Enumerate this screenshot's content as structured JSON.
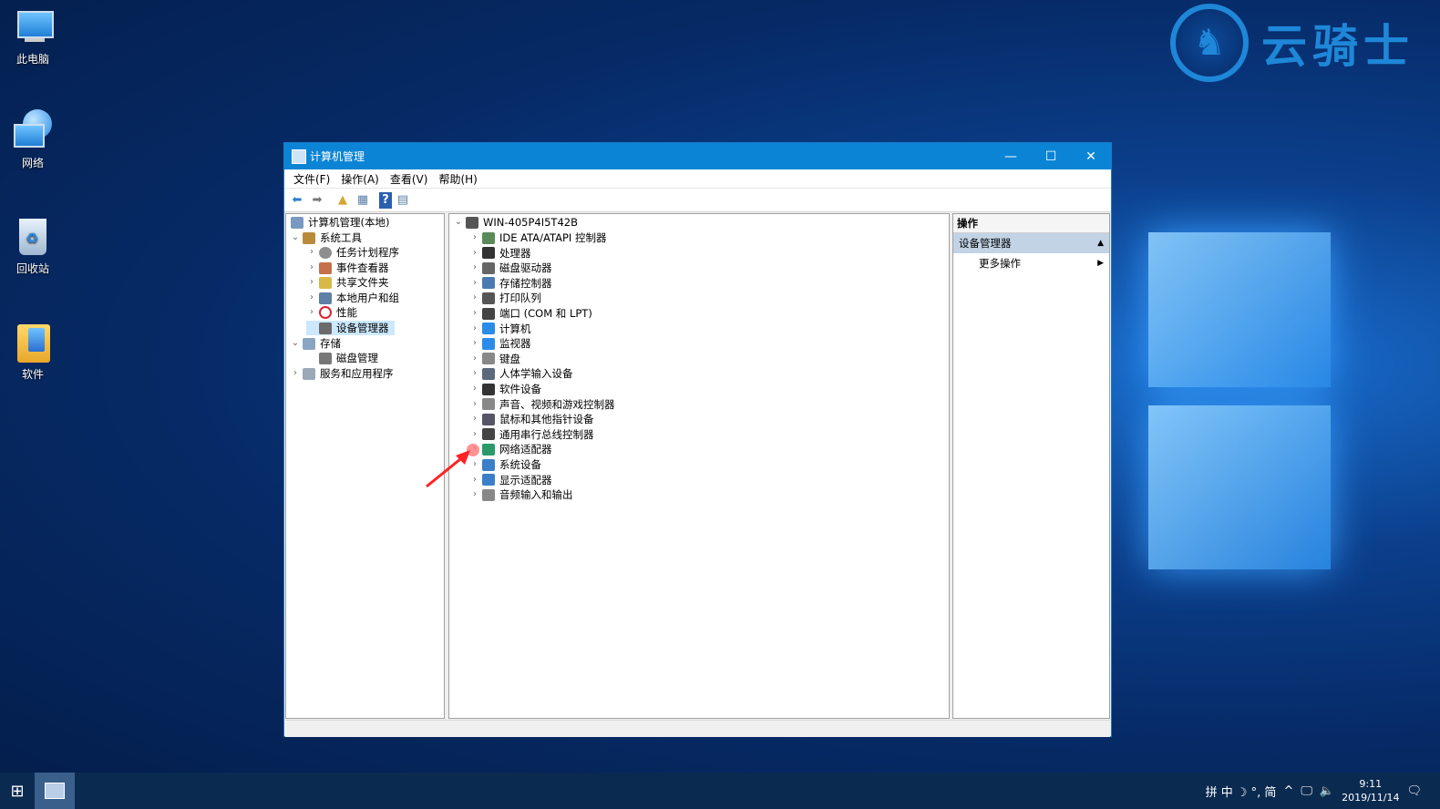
{
  "desktop": {
    "icons": [
      {
        "label": "此电脑"
      },
      {
        "label": "网络"
      },
      {
        "label": "回收站"
      },
      {
        "label": "软件"
      }
    ],
    "brand": "云骑士"
  },
  "window": {
    "title": "计算机管理",
    "controls": {
      "minimize": "—",
      "maximize": "☐",
      "close": "✕"
    },
    "menu": [
      "文件(F)",
      "操作(A)",
      "查看(V)",
      "帮助(H)"
    ]
  },
  "left_tree": [
    {
      "label": "计算机管理(本地)",
      "level": 0,
      "chevron": ""
    },
    {
      "label": "系统工具",
      "level": 1,
      "chevron": "⌄"
    },
    {
      "label": "任务计划程序",
      "level": 2,
      "chevron": "›"
    },
    {
      "label": "事件查看器",
      "level": 2,
      "chevron": "›"
    },
    {
      "label": "共享文件夹",
      "level": 2,
      "chevron": "›"
    },
    {
      "label": "本地用户和组",
      "level": 2,
      "chevron": "›"
    },
    {
      "label": "性能",
      "level": 2,
      "chevron": "›"
    },
    {
      "label": "设备管理器",
      "level": 2,
      "chevron": "",
      "selected": true
    },
    {
      "label": "存储",
      "level": 1,
      "chevron": "⌄"
    },
    {
      "label": "磁盘管理",
      "level": 2,
      "chevron": ""
    },
    {
      "label": "服务和应用程序",
      "level": 1,
      "chevron": "›"
    }
  ],
  "device_tree": {
    "root": "WIN-405P4I5T42B",
    "items": [
      "IDE ATA/ATAPI 控制器",
      "处理器",
      "磁盘驱动器",
      "存储控制器",
      "打印队列",
      "端口 (COM 和 LPT)",
      "计算机",
      "监视器",
      "键盘",
      "人体学输入设备",
      "软件设备",
      "声音、视频和游戏控制器",
      "鼠标和其他指针设备",
      "通用串行总线控制器",
      "网络适配器",
      "系统设备",
      "显示适配器",
      "音频输入和输出"
    ]
  },
  "actions": {
    "header": "操作",
    "selected": "设备管理器",
    "more": "更多操作"
  },
  "taskbar": {
    "ime": "拼 中 ☽ °, 简",
    "time": "9:11",
    "date": "2019/11/14"
  }
}
